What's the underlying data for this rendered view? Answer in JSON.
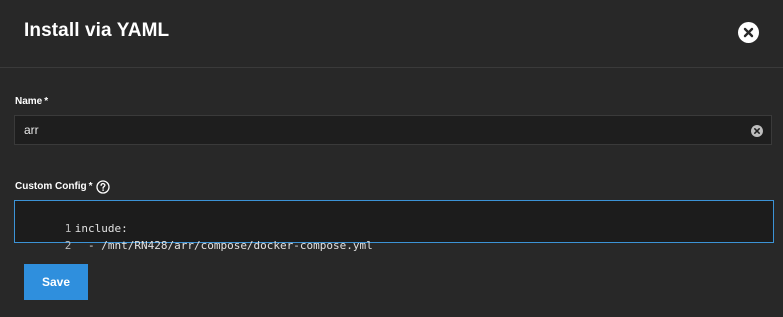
{
  "dialog": {
    "title": "Install via YAML"
  },
  "name_field": {
    "label": "Name",
    "required_mark": "*",
    "value": "arr",
    "placeholder": ""
  },
  "config_field": {
    "label": "Custom Config",
    "required_mark": "*",
    "lines": [
      {
        "number": "1",
        "text": "include:"
      },
      {
        "number": "2",
        "text": "  - /mnt/RN428/arr/compose/docker-compose.yml"
      }
    ]
  },
  "actions": {
    "save_label": "Save"
  },
  "icons": {
    "close": "close-icon",
    "clear": "clear-icon",
    "help": "help-icon"
  },
  "colors": {
    "background": "#282828",
    "input_background": "#1e1e1e",
    "accent": "#2f8fdd",
    "focus_border": "#3c93d6"
  }
}
